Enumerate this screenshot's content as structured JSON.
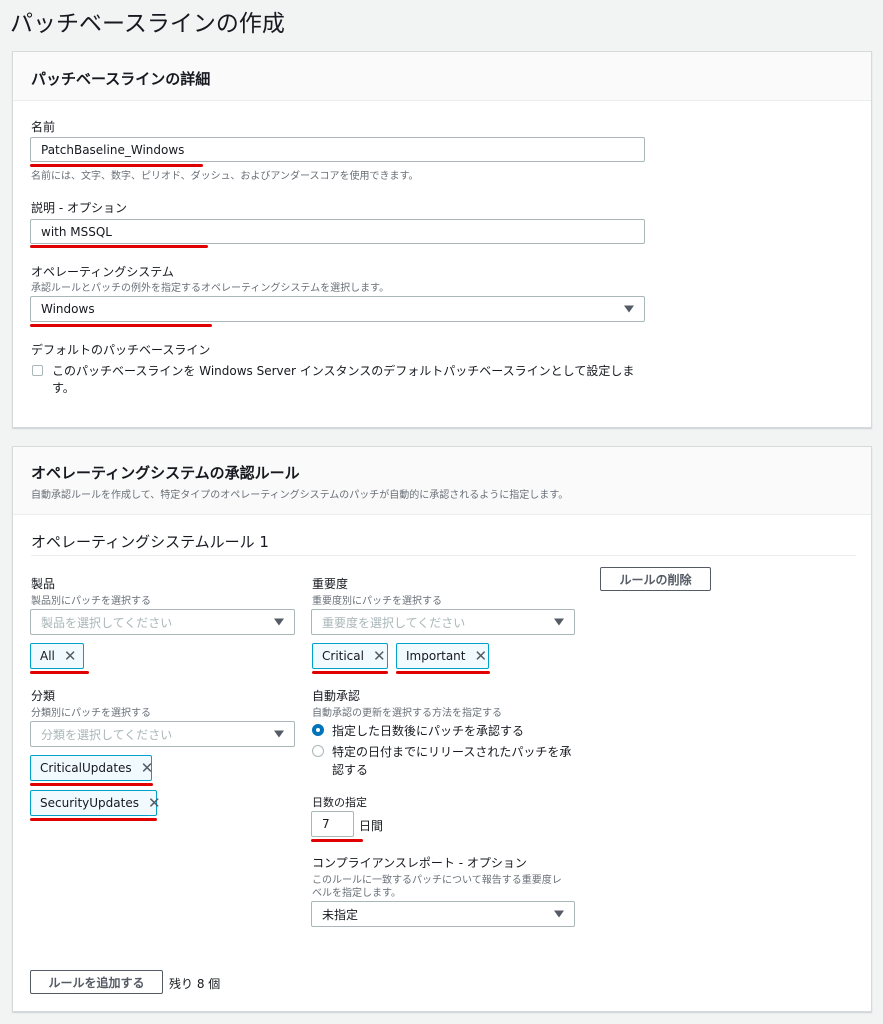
{
  "page_title": "パッチベースラインの作成",
  "details": {
    "heading": "パッチベースラインの詳細",
    "name_label": "名前",
    "name_value": "PatchBaseline_Windows",
    "name_hint": "名前には、文字、数字、ピリオド、ダッシュ、およびアンダースコアを使用できます。",
    "desc_label": "説明 - オプション",
    "desc_value": "with MSSQL",
    "os_label": "オペレーティングシステム",
    "os_hint": "承認ルールとパッチの例外を指定するオペレーティングシステムを選択します。",
    "os_value": "Windows",
    "default_label": "デフォルトのパッチベースライン",
    "default_checkbox_line1": "このパッチベースラインを Windows Server インスタンスのデフォルトパッチベースラインとして設定しま",
    "default_checkbox_line2": "す。"
  },
  "rules": {
    "heading": "オペレーティングシステムの承認ルール",
    "description": "自動承認ルールを作成して、特定タイプのオペレーティングシステムのパッチが自動的に承認されるように指定します。",
    "rule_title": "オペレーティングシステムルール 1",
    "delete_button": "ルールの削除",
    "product_label": "製品",
    "product_hint": "製品別にパッチを選択する",
    "product_placeholder": "製品を選択してください",
    "product_tokens": [
      "All"
    ],
    "classification_label": "分類",
    "classification_hint": "分類別にパッチを選択する",
    "classification_placeholder": "分類を選択してください",
    "classification_tokens": [
      "CriticalUpdates",
      "SecurityUpdates"
    ],
    "severity_label": "重要度",
    "severity_hint": "重要度別にパッチを選択する",
    "severity_placeholder": "重要度を選択してください",
    "severity_tokens": [
      "Critical",
      "Important"
    ],
    "auto_label": "自動承認",
    "auto_hint": "自動承認の更新を選択する方法を指定する",
    "auto_option1": "指定した日数後にパッチを承認する",
    "auto_option2_line1": "特定の日付までにリリースされたパッチを承",
    "auto_option2_line2": "認する",
    "days_label": "日数の指定",
    "days_value": "7",
    "days_unit": "日間",
    "compliance_label": "コンプライアンスレポート - オプション",
    "compliance_hint_line1": "このルールに一致するパッチについて報告する重要度レ",
    "compliance_hint_line2": "ベルを指定します。",
    "compliance_value": "未指定",
    "add_button": "ルールを追加する",
    "remaining": "残り 8 個"
  },
  "colors": {
    "accent": "#0073bb",
    "highlight": "#e00000",
    "token_border": "#00a1c9"
  }
}
